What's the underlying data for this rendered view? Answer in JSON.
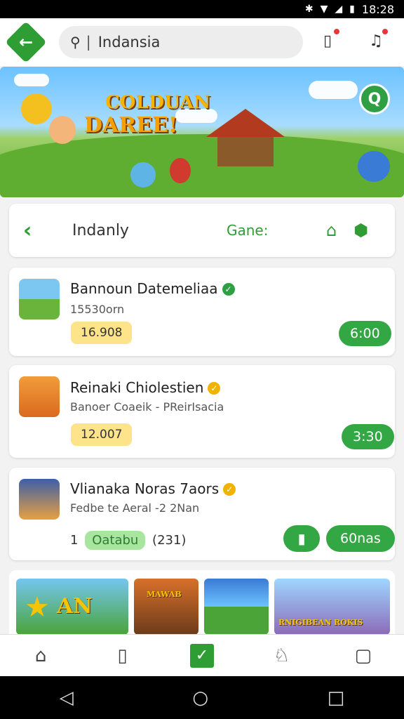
{
  "status_bar": {
    "time": "18:28",
    "icons": [
      "bluetooth-icon",
      "wifi-icon",
      "signal-icon",
      "battery-icon"
    ]
  },
  "header": {
    "search_text": "Indansia",
    "icons": [
      "back-arrow-icon",
      "search-icon",
      "clipboard-icon",
      "bell-icon"
    ]
  },
  "banner": {
    "title_line1": "COLDUAN",
    "title_line2": "DAREE!"
  },
  "filter": {
    "label": "Indanly",
    "game_label": "Gane:"
  },
  "games": [
    {
      "name": "Bannoun Datemeliaa",
      "subtitle": "15530orn",
      "price": "16.908",
      "action": "6:00",
      "verified_color": "#2ea043"
    },
    {
      "name": "Reinaki Chiolestien",
      "subtitle": "Banoer Coaeik - PReirIsacia",
      "price": "12.007",
      "action": "3:30",
      "verified_color": "#f0b400"
    },
    {
      "name": "Vlianaka Noras 7aors",
      "subtitle": "Fedbe te Aeral -2 2Nan",
      "count_prefix": "1",
      "tag": "Oatabu",
      "tag_suffix": "(231)",
      "action": "60nas",
      "verified_color": "#f0b400"
    }
  ],
  "strip": {
    "tile1_text": "AN",
    "tile2_text": "MAWAB",
    "tile4_text": "RNIGIBEAN ROKIS"
  },
  "bottom_nav": [
    "home-icon",
    "bookmark-icon",
    "check-icon",
    "trophy-icon",
    "bag-icon"
  ],
  "colors": {
    "brand_green": "#2e9e34",
    "action_green": "#34a745",
    "price_yellow": "#fde48a"
  }
}
